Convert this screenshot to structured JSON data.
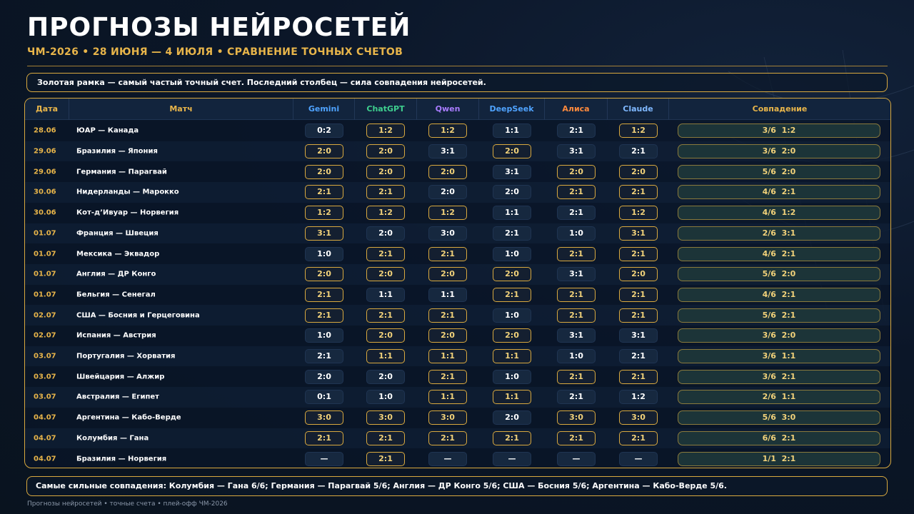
{
  "header": {
    "title": "ПРОГНОЗЫ НЕЙРОСЕТЕЙ",
    "subtitle": "ЧМ-2026 • 28 ИЮНЯ — 4 ИЮЛЯ • СРАВНЕНИЕ ТОЧНЫХ СЧЕТОВ"
  },
  "note": "Золотая рамка — самый частый точный счет. Последний столбец — сила совпадения нейросетей.",
  "colors": {
    "accent_gold": "#d9a93f",
    "gemini": "#4fa3ff",
    "chatgpt": "#3ecf8e",
    "qwen": "#a97cff",
    "deepseek": "#4fa3ff",
    "alisa": "#ff8a3d",
    "claude": "#7fb8ff"
  },
  "columns": {
    "date": "Дата",
    "match": "Матч",
    "gemini": "Gemini",
    "chatgpt": "ChatGPT",
    "qwen": "Qwen",
    "deepseek": "DeepSeek",
    "alisa": "Алиса",
    "claude": "Claude",
    "agreement": "Совпадение"
  },
  "rows": [
    {
      "date": "28.06",
      "match": "ЮАР — Канада",
      "scores": [
        "0:2",
        "1:2",
        "1:2",
        "1:1",
        "2:1",
        "1:2"
      ],
      "gold": [
        false,
        true,
        true,
        false,
        false,
        true
      ],
      "agreement": "3/6  1:2"
    },
    {
      "date": "29.06",
      "match": "Бразилия — Япония",
      "scores": [
        "2:0",
        "2:0",
        "3:1",
        "2:0",
        "3:1",
        "2:1"
      ],
      "gold": [
        true,
        true,
        false,
        true,
        false,
        false
      ],
      "agreement": "3/6  2:0"
    },
    {
      "date": "29.06",
      "match": "Германия — Парагвай",
      "scores": [
        "2:0",
        "2:0",
        "2:0",
        "3:1",
        "2:0",
        "2:0"
      ],
      "gold": [
        true,
        true,
        true,
        false,
        true,
        true
      ],
      "agreement": "5/6  2:0"
    },
    {
      "date": "30.06",
      "match": "Нидерланды — Марокко",
      "scores": [
        "2:1",
        "2:1",
        "2:0",
        "2:0",
        "2:1",
        "2:1"
      ],
      "gold": [
        true,
        true,
        false,
        false,
        true,
        true
      ],
      "agreement": "4/6  2:1"
    },
    {
      "date": "30.06",
      "match": "Кот-д’Ивуар — Норвегия",
      "scores": [
        "1:2",
        "1:2",
        "1:2",
        "1:1",
        "2:1",
        "1:2"
      ],
      "gold": [
        true,
        true,
        true,
        false,
        false,
        true
      ],
      "agreement": "4/6  1:2"
    },
    {
      "date": "01.07",
      "match": "Франция — Швеция",
      "scores": [
        "3:1",
        "2:0",
        "3:0",
        "2:1",
        "1:0",
        "3:1"
      ],
      "gold": [
        true,
        false,
        false,
        false,
        false,
        true
      ],
      "agreement": "2/6  3:1"
    },
    {
      "date": "01.07",
      "match": "Мексика — Эквадор",
      "scores": [
        "1:0",
        "2:1",
        "2:1",
        "1:0",
        "2:1",
        "2:1"
      ],
      "gold": [
        false,
        true,
        true,
        false,
        true,
        true
      ],
      "agreement": "4/6  2:1"
    },
    {
      "date": "01.07",
      "match": "Англия — ДР Конго",
      "scores": [
        "2:0",
        "2:0",
        "2:0",
        "2:0",
        "3:1",
        "2:0"
      ],
      "gold": [
        true,
        true,
        true,
        true,
        false,
        true
      ],
      "agreement": "5/6  2:0"
    },
    {
      "date": "01.07",
      "match": "Бельгия — Сенегал",
      "scores": [
        "2:1",
        "1:1",
        "1:1",
        "2:1",
        "2:1",
        "2:1"
      ],
      "gold": [
        true,
        false,
        false,
        true,
        true,
        true
      ],
      "agreement": "4/6  2:1"
    },
    {
      "date": "02.07",
      "match": "США — Босния и Герцеговина",
      "scores": [
        "2:1",
        "2:1",
        "2:1",
        "1:0",
        "2:1",
        "2:1"
      ],
      "gold": [
        true,
        true,
        true,
        false,
        true,
        true
      ],
      "agreement": "5/6  2:1"
    },
    {
      "date": "02.07",
      "match": "Испания — Австрия",
      "scores": [
        "1:0",
        "2:0",
        "2:0",
        "2:0",
        "3:1",
        "3:1"
      ],
      "gold": [
        false,
        true,
        true,
        true,
        false,
        false
      ],
      "agreement": "3/6  2:0"
    },
    {
      "date": "03.07",
      "match": "Португалия — Хорватия",
      "scores": [
        "2:1",
        "1:1",
        "1:1",
        "1:1",
        "1:0",
        "2:1"
      ],
      "gold": [
        false,
        true,
        true,
        true,
        false,
        false
      ],
      "agreement": "3/6  1:1"
    },
    {
      "date": "03.07",
      "match": "Швейцария — Алжир",
      "scores": [
        "2:0",
        "2:0",
        "2:1",
        "1:0",
        "2:1",
        "2:1"
      ],
      "gold": [
        false,
        false,
        true,
        false,
        true,
        true
      ],
      "agreement": "3/6  2:1"
    },
    {
      "date": "03.07",
      "match": "Австралия — Египет",
      "scores": [
        "0:1",
        "1:0",
        "1:1",
        "1:1",
        "2:1",
        "1:2"
      ],
      "gold": [
        false,
        false,
        true,
        true,
        false,
        false
      ],
      "agreement": "2/6  1:1"
    },
    {
      "date": "04.07",
      "match": "Аргентина — Кабо-Верде",
      "scores": [
        "3:0",
        "3:0",
        "3:0",
        "2:0",
        "3:0",
        "3:0"
      ],
      "gold": [
        true,
        true,
        true,
        false,
        true,
        true
      ],
      "agreement": "5/6  3:0"
    },
    {
      "date": "04.07",
      "match": "Колумбия — Гана",
      "scores": [
        "2:1",
        "2:1",
        "2:1",
        "2:1",
        "2:1",
        "2:1"
      ],
      "gold": [
        true,
        true,
        true,
        true,
        true,
        true
      ],
      "agreement": "6/6  2:1"
    },
    {
      "date": "04.07",
      "match": "Бразилия — Норвегия",
      "scores": [
        "—",
        "2:1",
        "—",
        "—",
        "—",
        "—"
      ],
      "gold": [
        false,
        true,
        false,
        false,
        false,
        false
      ],
      "agreement": "1/1  2:1"
    }
  ],
  "summary": "Самые сильные совпадения: Колумбия — Гана 6/6; Германия — Парагвай 5/6; Англия — ДР Конго 5/6; США — Босния 5/6; Аргентина — Кабо-Верде 5/6.",
  "footer": "Прогнозы нейросетей • точные счета • плей-офф ЧМ-2026"
}
